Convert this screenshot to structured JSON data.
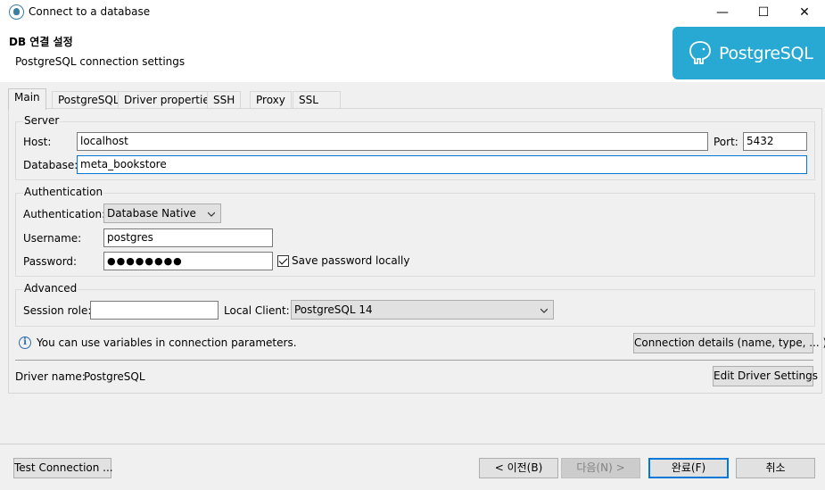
{
  "window": {
    "title": "Connect to a database",
    "minimize_glyph": "—",
    "maximize_glyph": "☐",
    "close_glyph": "✕"
  },
  "header": {
    "title": "DB 연결 설정",
    "subtitle": "PostgreSQL connection settings",
    "logo_text": "PostgreSQL",
    "logo_icon": "postgresql-elephant-icon",
    "accent_color": "#27a9d4"
  },
  "tabs": [
    {
      "label": "Main",
      "active": true
    },
    {
      "label": "PostgreSQL",
      "active": false
    },
    {
      "label": "Driver properties",
      "active": false
    },
    {
      "label": "SSH",
      "active": false
    },
    {
      "label": "Proxy",
      "active": false
    },
    {
      "label": "SSL",
      "active": false
    }
  ],
  "server": {
    "group_label": "Server",
    "host_label": "Host:",
    "host_value": "localhost",
    "port_label": "Port:",
    "port_value": "5432",
    "database_label": "Database:",
    "database_value": "meta_bookstore"
  },
  "authentication": {
    "group_label": "Authentication",
    "auth_label": "Authentication:",
    "auth_value": "Database Native",
    "username_label": "Username:",
    "username_value": "postgres",
    "password_label": "Password:",
    "password_value": "●●●●●●●●",
    "save_password_label": "Save password locally",
    "save_password_checked": true
  },
  "advanced": {
    "group_label": "Advanced",
    "session_role_label": "Session role:",
    "session_role_value": "",
    "local_client_label": "Local Client:",
    "local_client_value": "PostgreSQL 14"
  },
  "info": {
    "icon": "info-icon",
    "text": "You can use variables in connection parameters.",
    "connection_details_button": "Connection details (name, type, ... )"
  },
  "driver": {
    "name_label": "Driver name:",
    "name_value": "PostgreSQL",
    "edit_button": "Edit Driver Settings"
  },
  "footer": {
    "test_connection": "Test Connection ...",
    "back": "< 이전(B)",
    "next": "다음(N) >",
    "finish": "완료(F)",
    "cancel": "취소"
  }
}
